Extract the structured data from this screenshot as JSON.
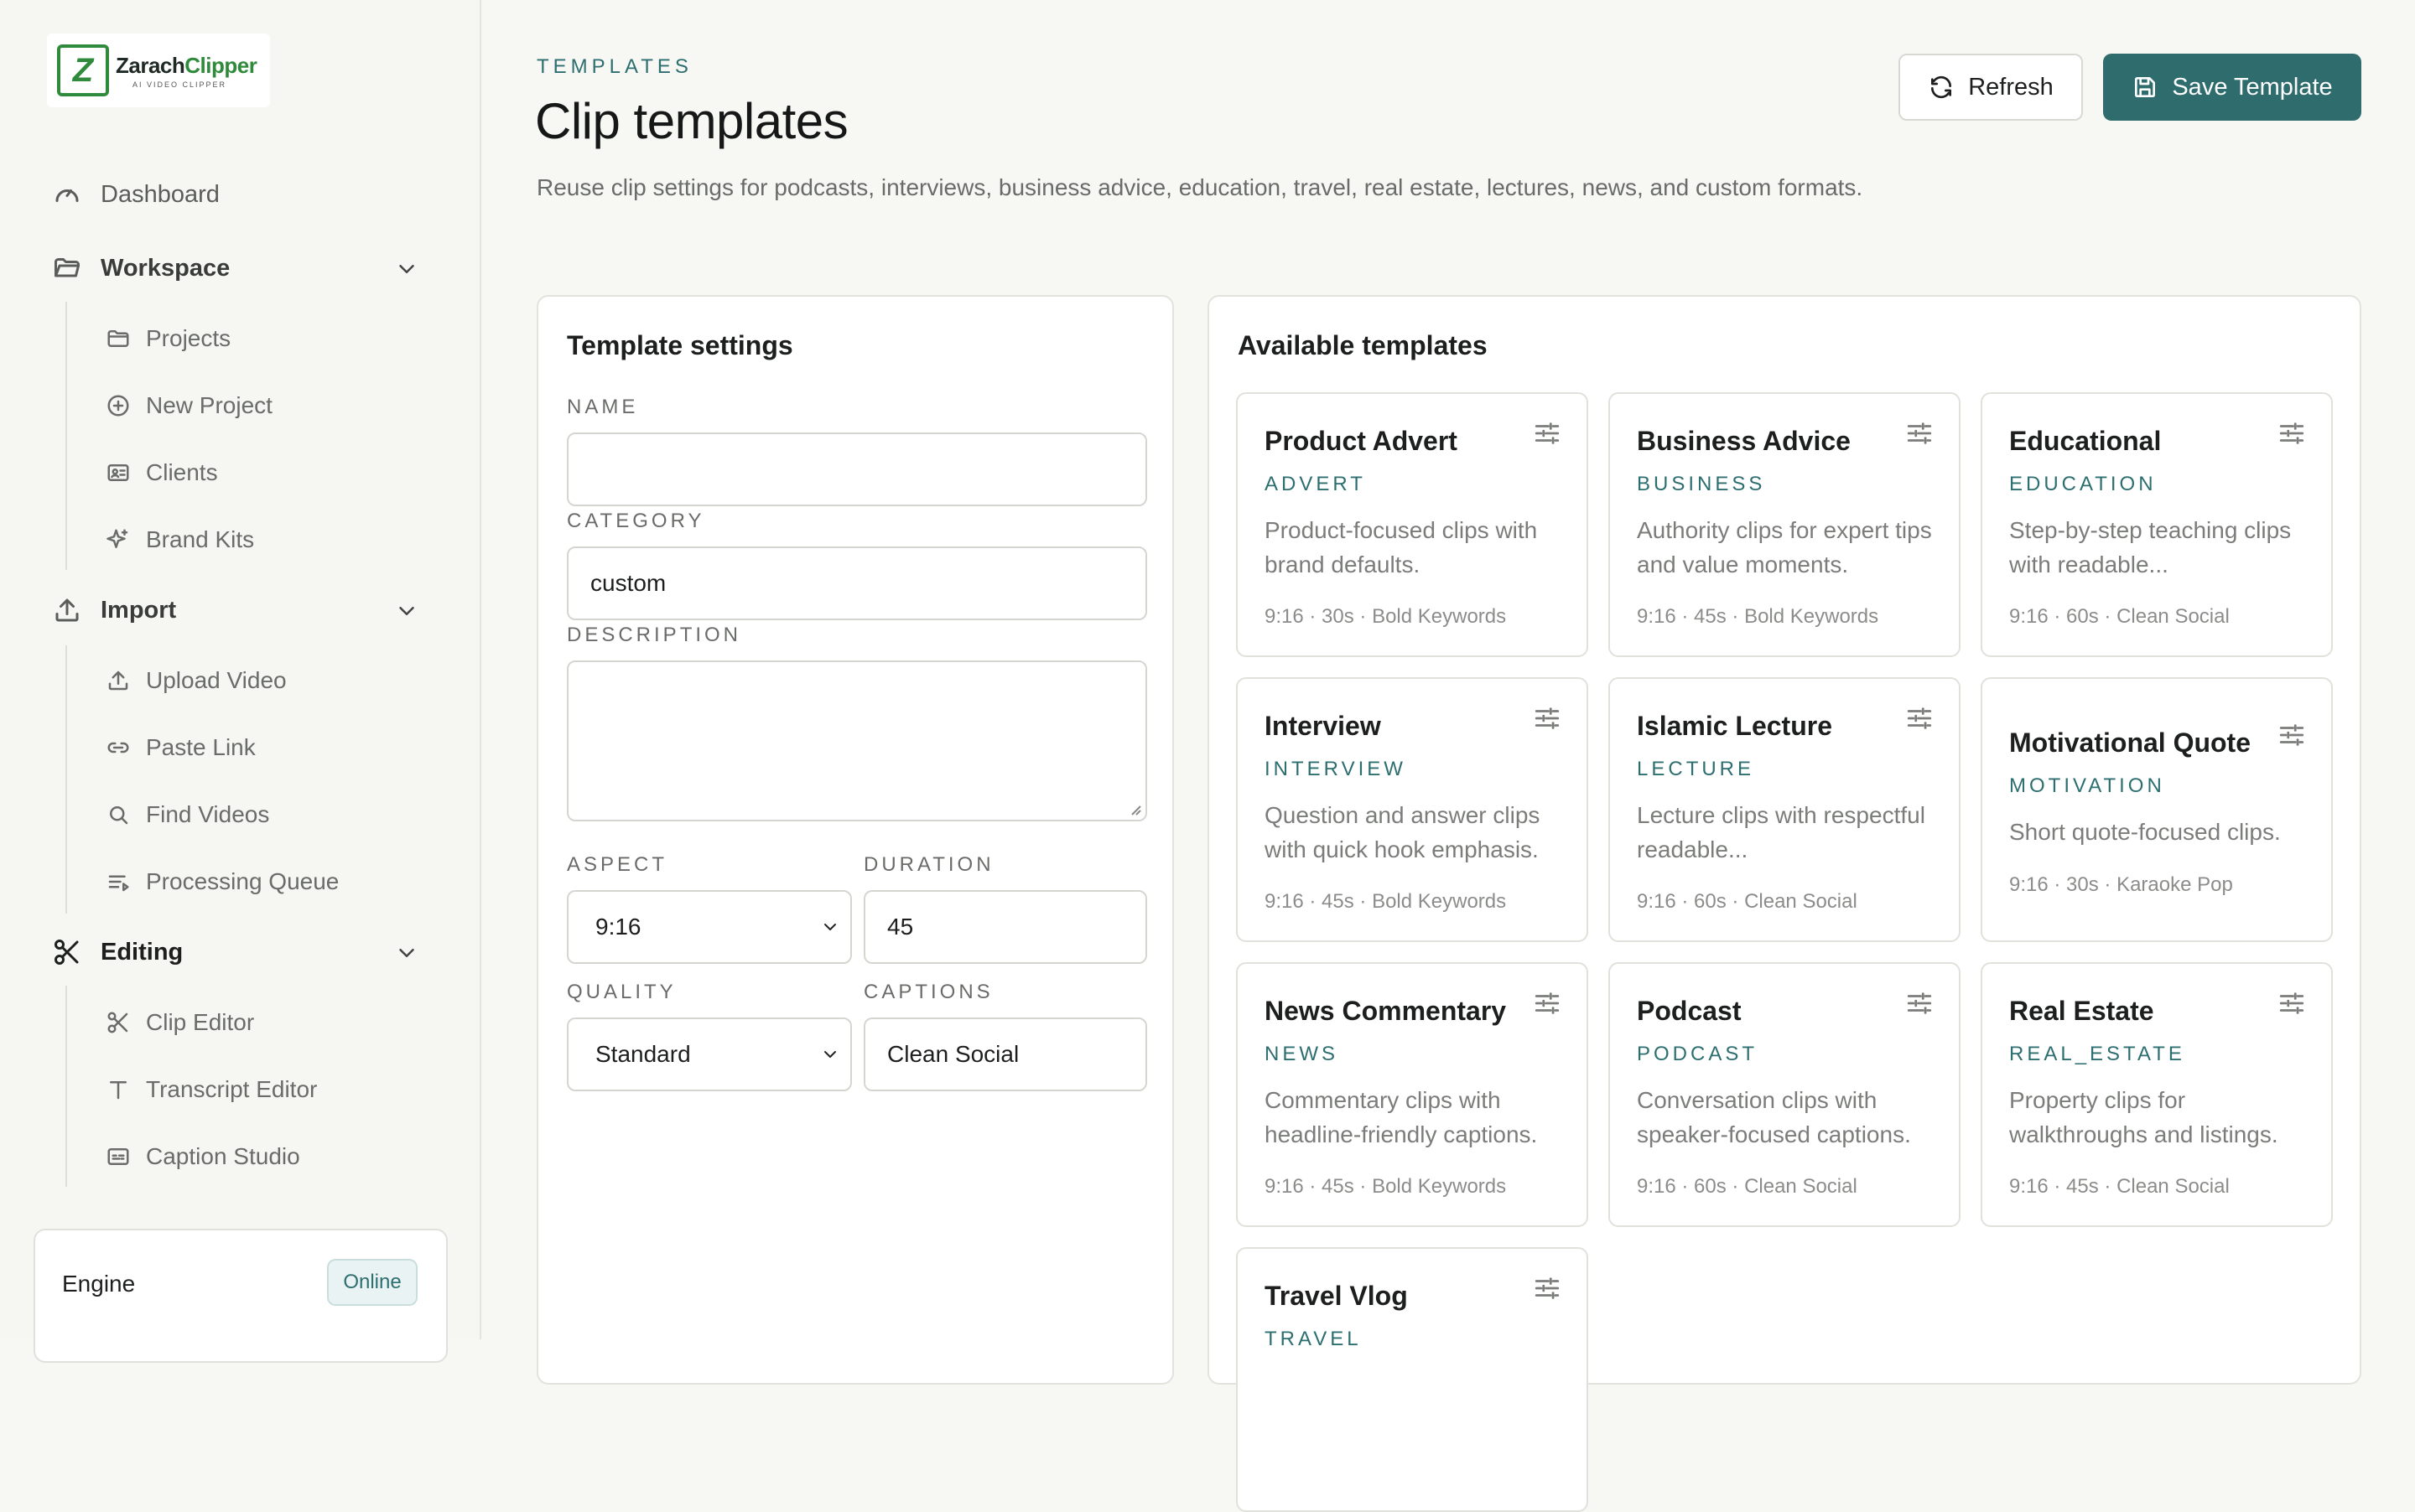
{
  "brand": {
    "name_prefix": "Zarach",
    "name_suffix": "Clipper",
    "tagline": "AI VIDEO CLIPPER"
  },
  "sidebar": {
    "dashboard": "Dashboard",
    "workspace": {
      "label": "Workspace",
      "items": [
        "Projects",
        "New Project",
        "Clients",
        "Brand Kits"
      ]
    },
    "import": {
      "label": "Import",
      "items": [
        "Upload Video",
        "Paste Link",
        "Find Videos",
        "Processing Queue"
      ]
    },
    "editing": {
      "label": "Editing",
      "items": [
        "Clip Editor",
        "Transcript Editor",
        "Caption Studio"
      ]
    },
    "engine": {
      "label": "Engine",
      "status": "Online"
    }
  },
  "header": {
    "eyebrow": "TEMPLATES",
    "title": "Clip templates",
    "description": "Reuse clip settings for podcasts, interviews, business advice, education, travel, real estate, lectures, news, and custom formats.",
    "refresh_label": "Refresh",
    "save_label": "Save Template"
  },
  "settings": {
    "title": "Template settings",
    "name": {
      "label": "NAME",
      "value": ""
    },
    "category": {
      "label": "CATEGORY",
      "value": "custom"
    },
    "description": {
      "label": "DESCRIPTION",
      "value": ""
    },
    "aspect": {
      "label": "ASPECT",
      "value": "9:16"
    },
    "duration": {
      "label": "DURATION",
      "value": "45"
    },
    "quality": {
      "label": "QUALITY",
      "value": "Standard"
    },
    "captions": {
      "label": "CAPTIONS",
      "value": "Clean Social"
    }
  },
  "available": {
    "title": "Available templates",
    "templates": [
      {
        "name": "Product Advert",
        "category": "ADVERT",
        "description": "Product-focused clips with brand defaults.",
        "meta": "9:16 · 30s · Bold Keywords"
      },
      {
        "name": "Business Advice",
        "category": "BUSINESS",
        "description": "Authority clips for expert tips and value moments.",
        "meta": "9:16 · 45s · Bold Keywords"
      },
      {
        "name": "Educational",
        "category": "EDUCATION",
        "description": "Step-by-step teaching clips with readable...",
        "meta": "9:16 · 60s · Clean Social"
      },
      {
        "name": "Interview",
        "category": "INTERVIEW",
        "description": "Question and answer clips with quick hook emphasis.",
        "meta": "9:16 · 45s · Bold Keywords"
      },
      {
        "name": "Islamic Lecture",
        "category": "LECTURE",
        "description": "Lecture clips with respectful readable...",
        "meta": "9:16 · 60s · Clean Social"
      },
      {
        "name": "Motivational Quote",
        "category": "MOTIVATION",
        "description": "Short quote-focused clips.",
        "meta": "9:16 · 30s · Karaoke Pop"
      },
      {
        "name": "News Commentary",
        "category": "NEWS",
        "description": "Commentary clips with headline-friendly captions.",
        "meta": "9:16 · 45s · Bold Keywords"
      },
      {
        "name": "Podcast",
        "category": "PODCAST",
        "description": "Conversation clips with speaker-focused captions.",
        "meta": "9:16 · 60s · Clean Social"
      },
      {
        "name": "Real Estate",
        "category": "REAL_ESTATE",
        "description": "Property clips for walkthroughs and listings.",
        "meta": "9:16 · 45s · Clean Social"
      },
      {
        "name": "Travel Vlog",
        "category": "TRAVEL",
        "description": "",
        "meta": ""
      }
    ]
  }
}
